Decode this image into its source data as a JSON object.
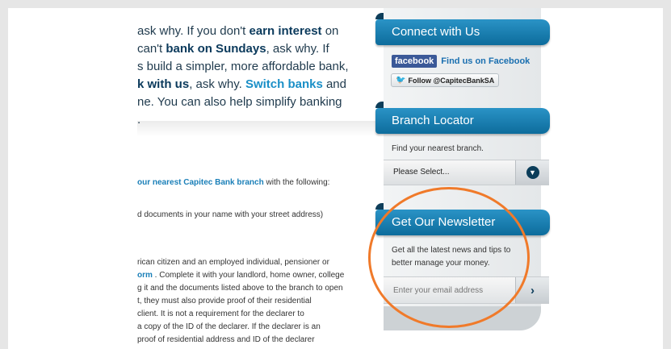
{
  "intro": {
    "l1_a": "ask why. If you don't ",
    "l1_b": "earn interest",
    "l1_c": " on",
    "l2_a": "can't ",
    "l2_b": "bank on Sundays",
    "l2_c": ", ask why. If",
    "l3": "s build a simpler, more affordable bank,",
    "l4_a": "k with us",
    "l4_b": ", ask why. ",
    "l4_c": "Switch banks",
    "l4_d": " and",
    "l5": "ne. You can also help simplify banking",
    "l6": "."
  },
  "article": {
    "branch_link": "our nearest Capitec Bank branch",
    "branch_rest": " with the following:",
    "docs": "d documents in your name with your street address)",
    "p1": "rican citizen and an employed individual, pensioner or",
    "p2_link": "orm",
    "p2_rest": " . Complete it with your landlord, home owner, college",
    "p3": "g it and the documents listed above to the branch to open",
    "p4": "t, they must also provide proof of their residential",
    "p5": "client. It is not a requirement for the declarer to",
    "p6": "a copy of the ID of the declarer. If the declarer is an",
    "p7": "proof of residential address and ID of the declarer"
  },
  "sidebar": {
    "connect_title": "Connect with Us",
    "facebook_badge": "facebook",
    "facebook_link": "Find us on Facebook",
    "twitter_follow": "Follow @CapitecBankSA",
    "branch_title": "Branch Locator",
    "branch_desc": "Find your nearest branch.",
    "branch_select": "Please Select...",
    "newsletter_title": "Get Our Newsletter",
    "newsletter_line1": "Get all the latest news and tips to",
    "newsletter_line2": "better manage your money.",
    "email_placeholder": "Enter your email address"
  },
  "colors": {
    "accent": "#1a8fc7",
    "header_bar": "#0d6c9c",
    "annotation_circle": "#f07a2a"
  }
}
